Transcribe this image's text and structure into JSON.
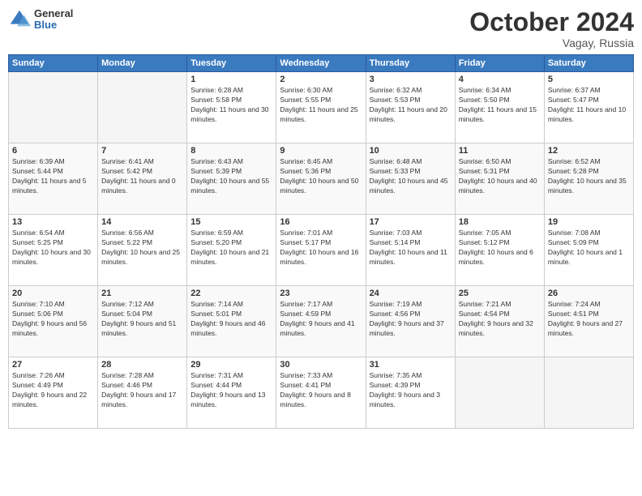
{
  "header": {
    "logo": {
      "general": "General",
      "blue": "Blue"
    },
    "month": "October 2024",
    "location": "Vagay, Russia"
  },
  "weekdays": [
    "Sunday",
    "Monday",
    "Tuesday",
    "Wednesday",
    "Thursday",
    "Friday",
    "Saturday"
  ],
  "weeks": [
    [
      {
        "day": "",
        "empty": true
      },
      {
        "day": "",
        "empty": true
      },
      {
        "day": "1",
        "sunrise": "6:28 AM",
        "sunset": "5:58 PM",
        "daylight": "11 hours and 30 minutes."
      },
      {
        "day": "2",
        "sunrise": "6:30 AM",
        "sunset": "5:55 PM",
        "daylight": "11 hours and 25 minutes."
      },
      {
        "day": "3",
        "sunrise": "6:32 AM",
        "sunset": "5:53 PM",
        "daylight": "11 hours and 20 minutes."
      },
      {
        "day": "4",
        "sunrise": "6:34 AM",
        "sunset": "5:50 PM",
        "daylight": "11 hours and 15 minutes."
      },
      {
        "day": "5",
        "sunrise": "6:37 AM",
        "sunset": "5:47 PM",
        "daylight": "11 hours and 10 minutes."
      }
    ],
    [
      {
        "day": "6",
        "sunrise": "6:39 AM",
        "sunset": "5:44 PM",
        "daylight": "11 hours and 5 minutes."
      },
      {
        "day": "7",
        "sunrise": "6:41 AM",
        "sunset": "5:42 PM",
        "daylight": "11 hours and 0 minutes."
      },
      {
        "day": "8",
        "sunrise": "6:43 AM",
        "sunset": "5:39 PM",
        "daylight": "10 hours and 55 minutes."
      },
      {
        "day": "9",
        "sunrise": "6:45 AM",
        "sunset": "5:36 PM",
        "daylight": "10 hours and 50 minutes."
      },
      {
        "day": "10",
        "sunrise": "6:48 AM",
        "sunset": "5:33 PM",
        "daylight": "10 hours and 45 minutes."
      },
      {
        "day": "11",
        "sunrise": "6:50 AM",
        "sunset": "5:31 PM",
        "daylight": "10 hours and 40 minutes."
      },
      {
        "day": "12",
        "sunrise": "6:52 AM",
        "sunset": "5:28 PM",
        "daylight": "10 hours and 35 minutes."
      }
    ],
    [
      {
        "day": "13",
        "sunrise": "6:54 AM",
        "sunset": "5:25 PM",
        "daylight": "10 hours and 30 minutes."
      },
      {
        "day": "14",
        "sunrise": "6:56 AM",
        "sunset": "5:22 PM",
        "daylight": "10 hours and 25 minutes."
      },
      {
        "day": "15",
        "sunrise": "6:59 AM",
        "sunset": "5:20 PM",
        "daylight": "10 hours and 21 minutes."
      },
      {
        "day": "16",
        "sunrise": "7:01 AM",
        "sunset": "5:17 PM",
        "daylight": "10 hours and 16 minutes."
      },
      {
        "day": "17",
        "sunrise": "7:03 AM",
        "sunset": "5:14 PM",
        "daylight": "10 hours and 11 minutes."
      },
      {
        "day": "18",
        "sunrise": "7:05 AM",
        "sunset": "5:12 PM",
        "daylight": "10 hours and 6 minutes."
      },
      {
        "day": "19",
        "sunrise": "7:08 AM",
        "sunset": "5:09 PM",
        "daylight": "10 hours and 1 minute."
      }
    ],
    [
      {
        "day": "20",
        "sunrise": "7:10 AM",
        "sunset": "5:06 PM",
        "daylight": "9 hours and 56 minutes."
      },
      {
        "day": "21",
        "sunrise": "7:12 AM",
        "sunset": "5:04 PM",
        "daylight": "9 hours and 51 minutes."
      },
      {
        "day": "22",
        "sunrise": "7:14 AM",
        "sunset": "5:01 PM",
        "daylight": "9 hours and 46 minutes."
      },
      {
        "day": "23",
        "sunrise": "7:17 AM",
        "sunset": "4:59 PM",
        "daylight": "9 hours and 41 minutes."
      },
      {
        "day": "24",
        "sunrise": "7:19 AM",
        "sunset": "4:56 PM",
        "daylight": "9 hours and 37 minutes."
      },
      {
        "day": "25",
        "sunrise": "7:21 AM",
        "sunset": "4:54 PM",
        "daylight": "9 hours and 32 minutes."
      },
      {
        "day": "26",
        "sunrise": "7:24 AM",
        "sunset": "4:51 PM",
        "daylight": "9 hours and 27 minutes."
      }
    ],
    [
      {
        "day": "27",
        "sunrise": "7:26 AM",
        "sunset": "4:49 PM",
        "daylight": "9 hours and 22 minutes."
      },
      {
        "day": "28",
        "sunrise": "7:28 AM",
        "sunset": "4:46 PM",
        "daylight": "9 hours and 17 minutes."
      },
      {
        "day": "29",
        "sunrise": "7:31 AM",
        "sunset": "4:44 PM",
        "daylight": "9 hours and 13 minutes."
      },
      {
        "day": "30",
        "sunrise": "7:33 AM",
        "sunset": "4:41 PM",
        "daylight": "9 hours and 8 minutes."
      },
      {
        "day": "31",
        "sunrise": "7:35 AM",
        "sunset": "4:39 PM",
        "daylight": "9 hours and 3 minutes."
      },
      {
        "day": "",
        "empty": true
      },
      {
        "day": "",
        "empty": true
      }
    ]
  ]
}
